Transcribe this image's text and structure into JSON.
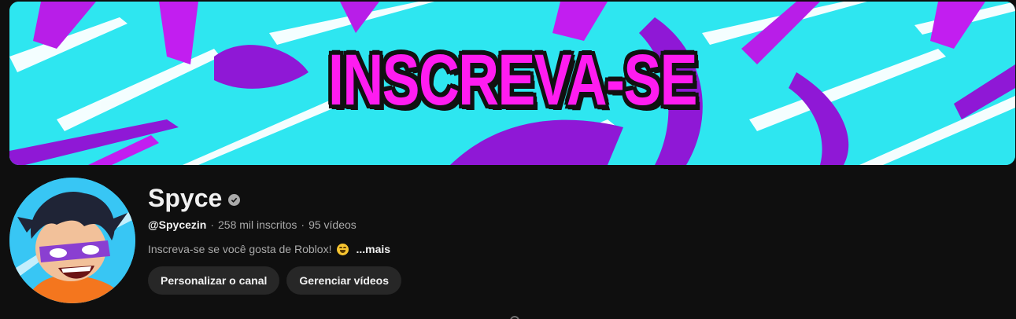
{
  "banner": {
    "title": "INSCREVA-SE",
    "colors": {
      "background": "#2ee6f0",
      "accent": "#ff1cf0",
      "stroke": "#8f18d6"
    }
  },
  "channel": {
    "name": "Spyce",
    "verified_icon": "verified-check-icon",
    "handle": "@Spycezin",
    "separator": "·",
    "subscribers": "258 mil inscritos",
    "videos": "95 vídeos",
    "description": "Inscreva-se se você gosta de Roblox!",
    "description_emoji": "grinning-face-icon",
    "more_label": "...mais"
  },
  "actions": {
    "customize_label": "Personalizar o canal",
    "manage_label": "Gerenciar vídeos"
  }
}
